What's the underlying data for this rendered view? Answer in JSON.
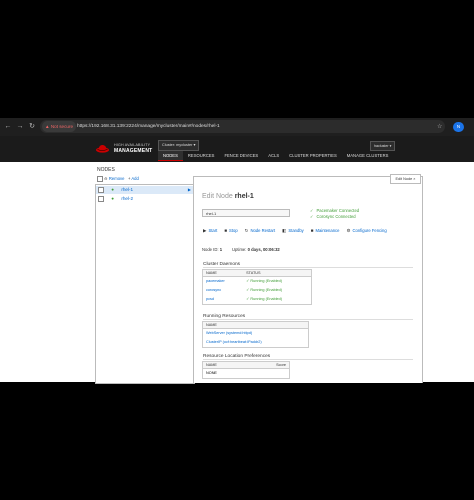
{
  "browser": {
    "secure_label": "Not secure",
    "url": "https://192.168.31.139:2224/manage/mycluster/main#/nodes/rhel-1"
  },
  "header": {
    "brand_line1": "HIGH AVAILABILITY",
    "brand_line2": "MANAGEMENT",
    "cluster_select": "Cluster: mycluster",
    "user_menu": "hacluster",
    "tabs": [
      {
        "label": "NODES",
        "active": true
      },
      {
        "label": "RESOURCES"
      },
      {
        "label": "FENCE DEVICES"
      },
      {
        "label": "ACLS"
      },
      {
        "label": "CLUSTER PROPERTIES"
      },
      {
        "label": "MANAGE CLUSTERS"
      }
    ]
  },
  "nodes_panel": {
    "title": "NODES",
    "remove_label": "Remove",
    "add_label": "Add",
    "nodes": [
      {
        "name": "rhel-1",
        "selected": true
      },
      {
        "name": "rhel-2",
        "selected": false
      }
    ]
  },
  "detail": {
    "edit_tab": "Edit Node",
    "title_prefix": "Edit Node",
    "node_name": "rhel-1",
    "input_value": "rhel-1",
    "status_lines": [
      "Pacemaker Connected",
      "Corosync Connected"
    ],
    "actions": [
      "Start",
      "Stop",
      "Node Restart",
      "Standby",
      "Maintenance",
      "Configure Fencing"
    ],
    "node_id_label": "Node ID:",
    "node_id": "1",
    "uptime_label": "Uptime:",
    "uptime": "0 days, 00:06:32",
    "daemons": {
      "title": "Cluster Daemons",
      "headers": [
        "NAME",
        "STATUS"
      ],
      "rows": [
        {
          "name": "pacemaker",
          "status": "Running (Enabled)"
        },
        {
          "name": "corosync",
          "status": "Running (Enabled)"
        },
        {
          "name": "pcsd",
          "status": "Running (Enabled)"
        }
      ]
    },
    "running": {
      "title": "Running Resources",
      "header": "NAME",
      "rows": [
        "WebServer (systemd:httpd)",
        "ClusterIP (ocf:heartbeat:IPaddr2)"
      ]
    },
    "preferences": {
      "title": "Resource Location Preferences",
      "headers": [
        "NAME",
        "Score"
      ],
      "empty": "NONE"
    }
  },
  "colors": {
    "accent_red": "#cc0000",
    "ok_green": "#3f9c35",
    "link_blue": "#0066cc"
  }
}
